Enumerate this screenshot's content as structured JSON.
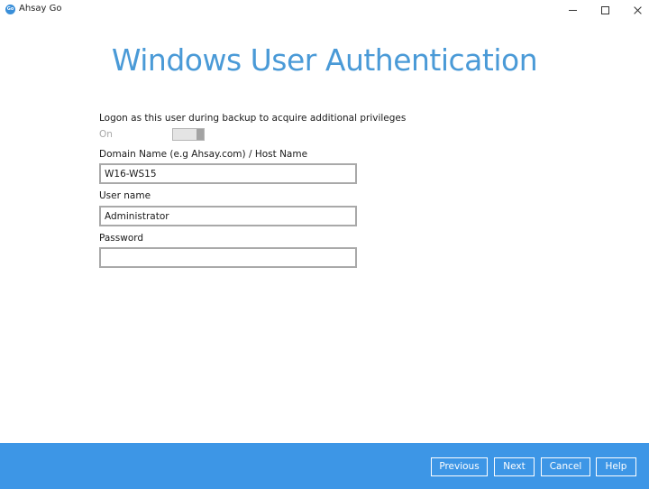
{
  "window": {
    "app_title": "Ahsay Go",
    "logo_text": "Go",
    "controls": [
      "minimize-icon",
      "maximize-icon",
      "close-icon"
    ]
  },
  "page": {
    "title": "Windows User Authentication"
  },
  "form": {
    "logon_label": "Logon as this user during backup to acquire additional privileges",
    "toggle_state": "On",
    "toggle_on": true,
    "domain_label": "Domain Name (e.g Ahsay.com) / Host Name",
    "domain_value": "W16-WS15",
    "username_label": "User name",
    "username_value": "Administrator",
    "password_label": "Password",
    "password_value": ""
  },
  "footer": {
    "previous_label": "Previous",
    "next_label": "Next",
    "cancel_label": "Cancel",
    "help_label": "Help"
  },
  "colors": {
    "title": "#4a9ad7",
    "footer": "#3d96e6",
    "logo": "#3a8fd9"
  }
}
